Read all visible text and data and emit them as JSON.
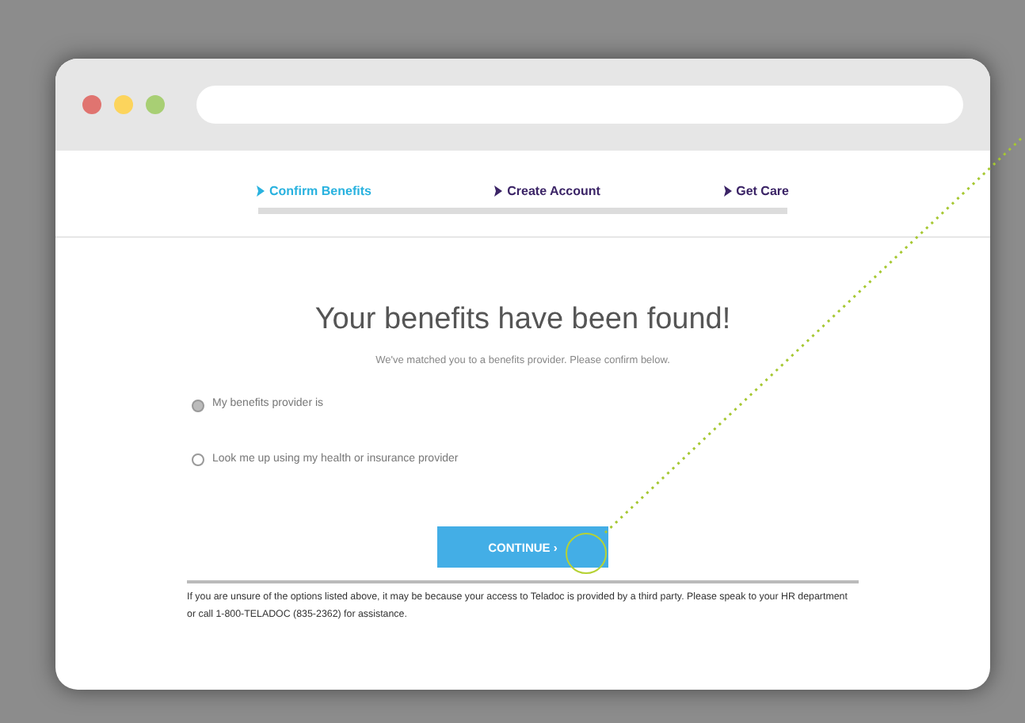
{
  "steps": [
    {
      "label": "Confirm Benefits",
      "selected": true
    },
    {
      "label": "Create Account",
      "selected": false
    },
    {
      "label": "Get Care",
      "selected": false
    }
  ],
  "heading": "Your benefits have been found!",
  "subheading": "We've matched you to a benefits provider. Please confirm below.",
  "options": [
    {
      "label": "My benefits provider is",
      "selected": true
    },
    {
      "label": "Look me up using my health or insurance provider",
      "selected": false
    }
  ],
  "continue_button": "CONTINUE ›",
  "footnote": "If you are unsure of the options listed above, it may be because your access to Teladoc is provided by a third party. Please speak to your HR department or call 1-800-TELADOC (835-2362) for assistance."
}
